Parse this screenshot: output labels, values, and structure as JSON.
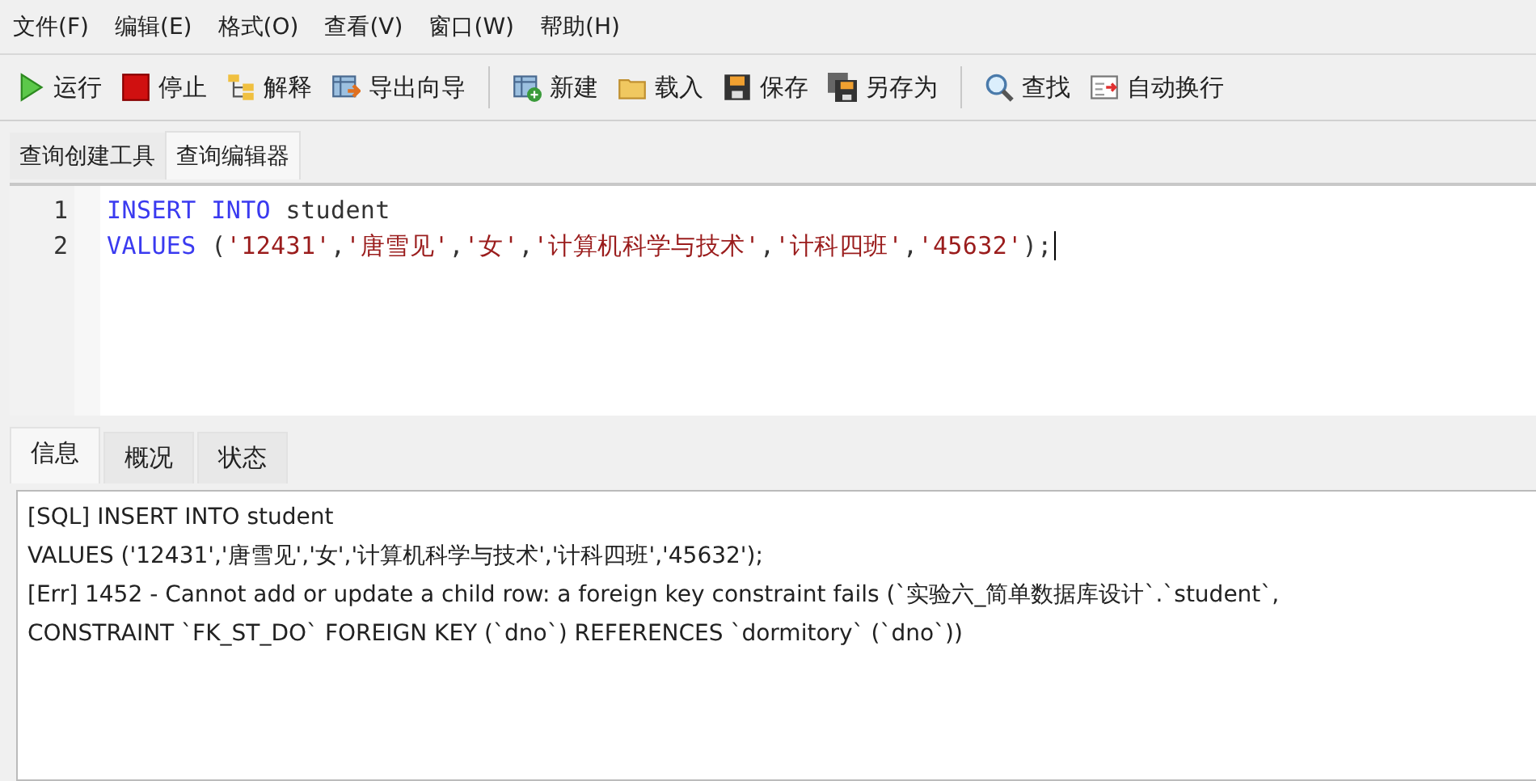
{
  "menu": [
    "文件(F)",
    "编辑(E)",
    "格式(O)",
    "查看(V)",
    "窗口(W)",
    "帮助(H)"
  ],
  "toolbar_groups": [
    [
      {
        "kind": "run",
        "label": "运行"
      },
      {
        "kind": "stop",
        "label": "停止"
      },
      {
        "kind": "explain",
        "label": "解释"
      },
      {
        "kind": "export",
        "label": "导出向导"
      }
    ],
    [
      {
        "kind": "new",
        "label": "新建"
      },
      {
        "kind": "load",
        "label": "载入"
      },
      {
        "kind": "save",
        "label": "保存"
      },
      {
        "kind": "saveas",
        "label": "另存为"
      }
    ],
    [
      {
        "kind": "find",
        "label": "查找"
      },
      {
        "kind": "wrap",
        "label": "自动换行"
      }
    ]
  ],
  "tabs": [
    {
      "label": "查询创建工具",
      "selected": false
    },
    {
      "label": "查询编辑器",
      "selected": true
    }
  ],
  "editor": {
    "lines": [
      {
        "number": "1",
        "tokens": [
          {
            "kind": "keyword",
            "text": "INSERT INTO"
          },
          {
            "kind": "plain",
            "text": " student"
          }
        ]
      },
      {
        "number": "2",
        "tokens": [
          {
            "kind": "keyword",
            "text": "VALUES"
          },
          {
            "kind": "plain",
            "text": " ("
          },
          {
            "kind": "string",
            "text": "'12431'"
          },
          {
            "kind": "plain",
            "text": ","
          },
          {
            "kind": "string",
            "text": "'唐雪见'"
          },
          {
            "kind": "plain",
            "text": ","
          },
          {
            "kind": "string",
            "text": "'女'"
          },
          {
            "kind": "plain",
            "text": ","
          },
          {
            "kind": "string",
            "text": "'计算机科学与技术'"
          },
          {
            "kind": "plain",
            "text": ","
          },
          {
            "kind": "string",
            "text": "'计科四班'"
          },
          {
            "kind": "plain",
            "text": ","
          },
          {
            "kind": "string",
            "text": "'45632'"
          },
          {
            "kind": "plain",
            "text": ");"
          }
        ],
        "cursor": true
      }
    ]
  },
  "result_tabs": [
    {
      "label": "信息",
      "selected": true
    },
    {
      "label": "概况",
      "selected": false
    },
    {
      "label": "状态",
      "selected": false
    }
  ],
  "messages": [
    "[SQL] INSERT INTO student",
    "VALUES ('12431','唐雪见','女','计算机科学与技术','计科四班','45632');",
    "[Err] 1452 - Cannot add or update a child row: a foreign key constraint fails (`实验六_简单数据库设计`.`student`,",
    "CONSTRAINT `FK_ST_DO` FOREIGN KEY (`dno`) REFERENCES `dormitory` (`dno`))"
  ]
}
